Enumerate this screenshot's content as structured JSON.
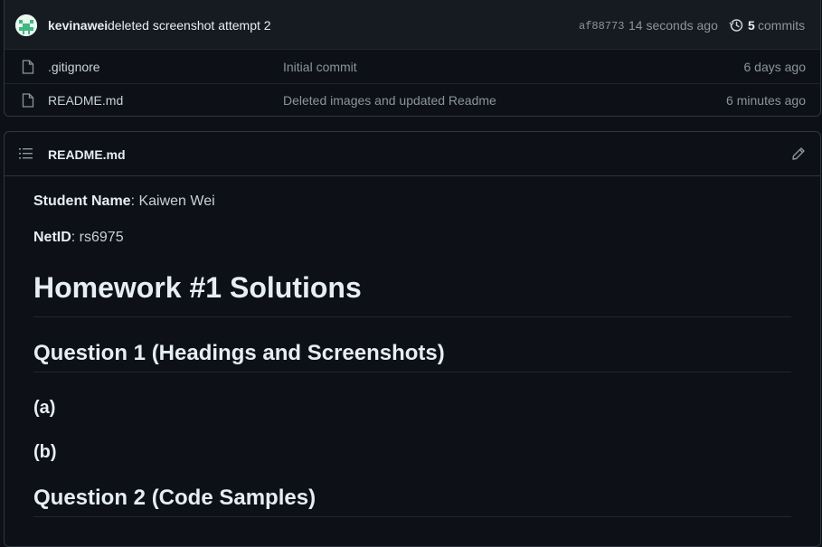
{
  "latest_commit": {
    "author": "kevinawei",
    "message": "deleted screenshot attempt 2",
    "sha": "af88773",
    "time_ago": "14 seconds ago",
    "commits_count": "5",
    "commits_label": "commits"
  },
  "files": [
    {
      "name": ".gitignore",
      "commit_message": "Initial commit",
      "date": "6 days ago",
      "icon": "file-icon"
    },
    {
      "name": "README.md",
      "commit_message": "Deleted images and updated Readme",
      "date": "6 minutes ago",
      "icon": "file-icon"
    }
  ],
  "readme": {
    "title": "README.md",
    "student_name_label": "Student Name",
    "student_name_value": ": Kaiwen Wei",
    "netid_label": "NetID",
    "netid_value": ": rs6975",
    "h1": "Homework #1 Solutions",
    "q1_heading": "Question 1 (Headings and Screenshots)",
    "sub_a": "(a)",
    "sub_b": "(b)",
    "q2_heading": "Question 2 (Code Samples)"
  },
  "colors": {
    "background": "#0d1117",
    "border": "#30363d",
    "muted_text": "#8b949e",
    "text": "#c9d1d9"
  }
}
